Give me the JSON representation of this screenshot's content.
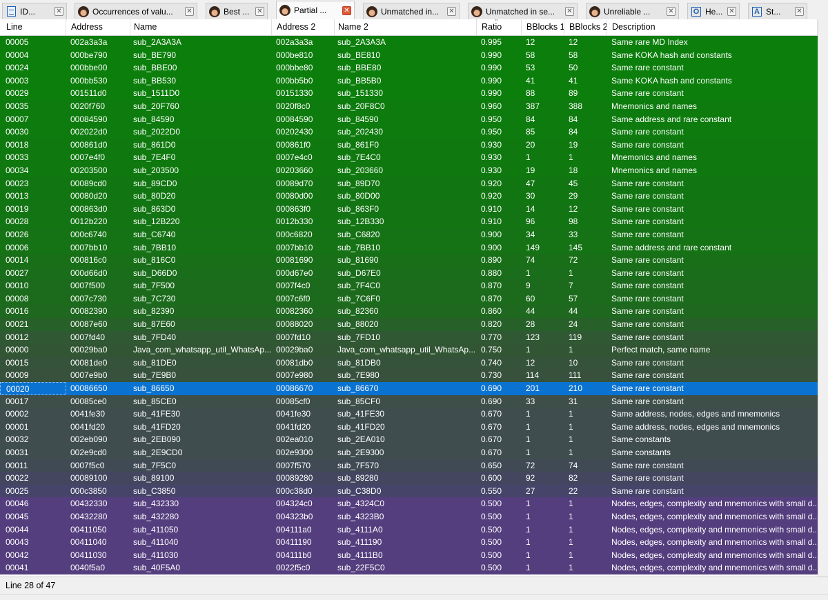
{
  "tabs": [
    {
      "label": "ID...",
      "icon": "document-icon",
      "active": false
    },
    {
      "label": "Occurrences of valu...",
      "icon": "avatar-icon",
      "active": false
    },
    {
      "label": "Best ...",
      "icon": "avatar-icon",
      "active": false
    },
    {
      "label": "Partial ...",
      "icon": "avatar-icon",
      "active": true
    },
    {
      "label": "Unmatched in...",
      "icon": "avatar-icon",
      "active": false
    },
    {
      "label": "Unmatched in se...",
      "icon": "avatar-icon",
      "active": false
    },
    {
      "label": "Unreliable ...",
      "icon": "avatar-icon",
      "active": false
    },
    {
      "label": "He...",
      "icon": "hex-view-icon",
      "active": false
    },
    {
      "label": "St...",
      "icon": "strings-icon",
      "active": false
    }
  ],
  "tab_close_glyph": "✕",
  "table": {
    "columns": [
      "Line",
      "Address",
      "Name",
      "Address 2",
      "Name 2",
      "Ratio",
      "BBlocks 1",
      "BBlocks 2",
      "Description"
    ],
    "sorted_column": "Ratio",
    "sort_glyph": "^",
    "rows": [
      [
        "00005",
        "002a3a3a",
        "sub_2A3A3A",
        "002a3a3a",
        "sub_2A3A3A",
        "0.995",
        "12",
        "12",
        "Same rare MD Index"
      ],
      [
        "00004",
        "000be790",
        "sub_BE790",
        "000be810",
        "sub_BE810",
        "0.990",
        "58",
        "58",
        "Same KOKA hash and constants"
      ],
      [
        "00024",
        "000bbe00",
        "sub_BBE00",
        "000bbe80",
        "sub_BBE80",
        "0.990",
        "53",
        "50",
        "Same rare constant"
      ],
      [
        "00003",
        "000bb530",
        "sub_BB530",
        "000bb5b0",
        "sub_BB5B0",
        "0.990",
        "41",
        "41",
        "Same KOKA hash and constants"
      ],
      [
        "00029",
        "001511d0",
        "sub_1511D0",
        "00151330",
        "sub_151330",
        "0.990",
        "88",
        "89",
        "Same rare constant"
      ],
      [
        "00035",
        "0020f760",
        "sub_20F760",
        "0020f8c0",
        "sub_20F8C0",
        "0.960",
        "387",
        "388",
        "Mnemonics and names"
      ],
      [
        "00007",
        "00084590",
        "sub_84590",
        "00084590",
        "sub_84590",
        "0.950",
        "84",
        "84",
        "Same address and rare constant"
      ],
      [
        "00030",
        "002022d0",
        "sub_2022D0",
        "00202430",
        "sub_202430",
        "0.950",
        "85",
        "84",
        "Same rare constant"
      ],
      [
        "00018",
        "000861d0",
        "sub_861D0",
        "000861f0",
        "sub_861F0",
        "0.930",
        "20",
        "19",
        "Same rare constant"
      ],
      [
        "00033",
        "0007e4f0",
        "sub_7E4F0",
        "0007e4c0",
        "sub_7E4C0",
        "0.930",
        "1",
        "1",
        "Mnemonics and names"
      ],
      [
        "00034",
        "00203500",
        "sub_203500",
        "00203660",
        "sub_203660",
        "0.930",
        "19",
        "18",
        "Mnemonics and names"
      ],
      [
        "00023",
        "00089cd0",
        "sub_89CD0",
        "00089d70",
        "sub_89D70",
        "0.920",
        "47",
        "45",
        "Same rare constant"
      ],
      [
        "00013",
        "00080d20",
        "sub_80D20",
        "00080d00",
        "sub_80D00",
        "0.920",
        "30",
        "29",
        "Same rare constant"
      ],
      [
        "00019",
        "000863d0",
        "sub_863D0",
        "000863f0",
        "sub_863F0",
        "0.910",
        "14",
        "12",
        "Same rare constant"
      ],
      [
        "00028",
        "0012b220",
        "sub_12B220",
        "0012b330",
        "sub_12B330",
        "0.910",
        "96",
        "98",
        "Same rare constant"
      ],
      [
        "00026",
        "000c6740",
        "sub_C6740",
        "000c6820",
        "sub_C6820",
        "0.900",
        "34",
        "33",
        "Same rare constant"
      ],
      [
        "00006",
        "0007bb10",
        "sub_7BB10",
        "0007bb10",
        "sub_7BB10",
        "0.900",
        "149",
        "145",
        "Same address and rare constant"
      ],
      [
        "00014",
        "000816c0",
        "sub_816C0",
        "00081690",
        "sub_81690",
        "0.890",
        "74",
        "72",
        "Same rare constant"
      ],
      [
        "00027",
        "000d66d0",
        "sub_D66D0",
        "000d67e0",
        "sub_D67E0",
        "0.880",
        "1",
        "1",
        "Same rare constant"
      ],
      [
        "00010",
        "0007f500",
        "sub_7F500",
        "0007f4c0",
        "sub_7F4C0",
        "0.870",
        "9",
        "7",
        "Same rare constant"
      ],
      [
        "00008",
        "0007c730",
        "sub_7C730",
        "0007c6f0",
        "sub_7C6F0",
        "0.870",
        "60",
        "57",
        "Same rare constant"
      ],
      [
        "00016",
        "00082390",
        "sub_82390",
        "00082360",
        "sub_82360",
        "0.860",
        "44",
        "44",
        "Same rare constant"
      ],
      [
        "00021",
        "00087e60",
        "sub_87E60",
        "00088020",
        "sub_88020",
        "0.820",
        "28",
        "24",
        "Same rare constant"
      ],
      [
        "00012",
        "0007fd40",
        "sub_7FD40",
        "0007fd10",
        "sub_7FD10",
        "0.770",
        "123",
        "119",
        "Same rare constant"
      ],
      [
        "00000",
        "00029ba0",
        "Java_com_whatsapp_util_WhatsAp...",
        "00029ba0",
        "Java_com_whatsapp_util_WhatsAp...",
        "0.750",
        "1",
        "1",
        "Perfect match, same name"
      ],
      [
        "00015",
        "00081de0",
        "sub_81DE0",
        "00081db0",
        "sub_81DB0",
        "0.740",
        "12",
        "10",
        "Same rare constant"
      ],
      [
        "00009",
        "0007e9b0",
        "sub_7E9B0",
        "0007e980",
        "sub_7E980",
        "0.730",
        "114",
        "111",
        "Same rare constant"
      ],
      [
        "00020",
        "00086650",
        "sub_86650",
        "00086670",
        "sub_86670",
        "0.690",
        "201",
        "210",
        "Same rare constant"
      ],
      [
        "00017",
        "00085ce0",
        "sub_85CE0",
        "00085cf0",
        "sub_85CF0",
        "0.690",
        "33",
        "31",
        "Same rare constant"
      ],
      [
        "00002",
        "0041fe30",
        "sub_41FE30",
        "0041fe30",
        "sub_41FE30",
        "0.670",
        "1",
        "1",
        "Same address, nodes, edges and mnemonics"
      ],
      [
        "00001",
        "0041fd20",
        "sub_41FD20",
        "0041fd20",
        "sub_41FD20",
        "0.670",
        "1",
        "1",
        "Same address, nodes, edges and mnemonics"
      ],
      [
        "00032",
        "002eb090",
        "sub_2EB090",
        "002ea010",
        "sub_2EA010",
        "0.670",
        "1",
        "1",
        "Same constants"
      ],
      [
        "00031",
        "002e9cd0",
        "sub_2E9CD0",
        "002e9300",
        "sub_2E9300",
        "0.670",
        "1",
        "1",
        "Same constants"
      ],
      [
        "00011",
        "0007f5c0",
        "sub_7F5C0",
        "0007f570",
        "sub_7F570",
        "0.650",
        "72",
        "74",
        "Same rare constant"
      ],
      [
        "00022",
        "00089100",
        "sub_89100",
        "00089280",
        "sub_89280",
        "0.600",
        "92",
        "82",
        "Same rare constant"
      ],
      [
        "00025",
        "000c3850",
        "sub_C3850",
        "000c38d0",
        "sub_C38D0",
        "0.550",
        "27",
        "22",
        "Same rare constant"
      ],
      [
        "00046",
        "00432330",
        "sub_432330",
        "004324c0",
        "sub_4324C0",
        "0.500",
        "1",
        "1",
        "Nodes, edges, complexity and mnemonics with small d..."
      ],
      [
        "00045",
        "00432280",
        "sub_432280",
        "004323b0",
        "sub_4323B0",
        "0.500",
        "1",
        "1",
        "Nodes, edges, complexity and mnemonics with small d..."
      ],
      [
        "00044",
        "00411050",
        "sub_411050",
        "004111a0",
        "sub_4111A0",
        "0.500",
        "1",
        "1",
        "Nodes, edges, complexity and mnemonics with small d..."
      ],
      [
        "00043",
        "00411040",
        "sub_411040",
        "00411190",
        "sub_411190",
        "0.500",
        "1",
        "1",
        "Nodes, edges, complexity and mnemonics with small d..."
      ],
      [
        "00042",
        "00411030",
        "sub_411030",
        "004111b0",
        "sub_4111B0",
        "0.500",
        "1",
        "1",
        "Nodes, edges, complexity and mnemonics with small d..."
      ],
      [
        "00041",
        "0040f5a0",
        "sub_40F5A0",
        "0022f5c0",
        "sub_22F5C0",
        "0.500",
        "1",
        "1",
        "Nodes, edges, complexity and mnemonics with small d..."
      ]
    ],
    "row_colors": [
      "#0b7e0b",
      "#0b7e0b",
      "#0b7e0b",
      "#0b7e0b",
      "#0b7e0b",
      "#0d7b0d",
      "#0d7b0d",
      "#0d7b0d",
      "#0f790f",
      "#0f790f",
      "#0f790f",
      "#117611",
      "#117611",
      "#137413",
      "#137413",
      "#157215",
      "#157215",
      "#186f18",
      "#1a6d1a",
      "#1c6b1c",
      "#1c6b1c",
      "#1f681f",
      "#276028",
      "#2f5833",
      "#325634",
      "#35533a",
      "#37513d",
      "#0a73d1",
      "#3e4f4a",
      "#3f4d4f",
      "#3f4d4f",
      "#3f4d4f",
      "#3f4d4f",
      "#404a55",
      "#44465f",
      "#47446a",
      "#543e7e",
      "#543e7e",
      "#543e7e",
      "#543e7e",
      "#543e7e",
      "#543e7e"
    ],
    "selected_row_line": "00020"
  },
  "status": {
    "text": "Line 28 of 47"
  }
}
